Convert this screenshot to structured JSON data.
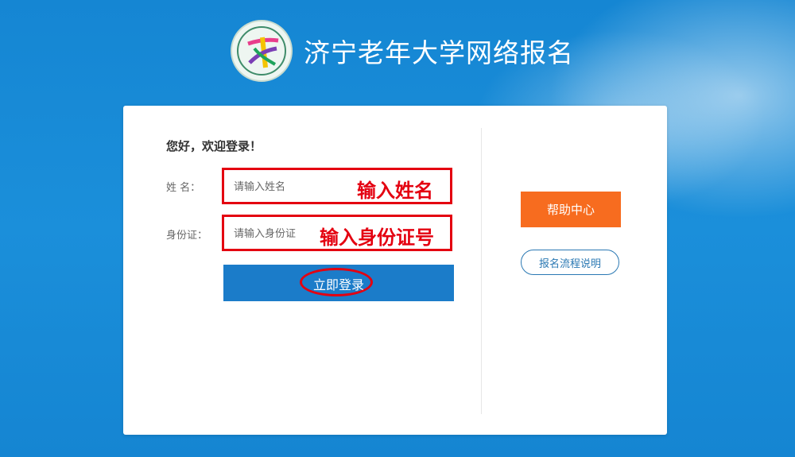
{
  "header": {
    "title": "济宁老年大学网络报名",
    "logo_icon": "school-emblem-icon"
  },
  "login": {
    "greeting": "您好，欢迎登录！",
    "name_label": "姓 名：",
    "name_placeholder": "请输入姓名",
    "name_annotation": "输入姓名",
    "id_label": "身份证：",
    "id_placeholder": "请输入身份证",
    "id_annotation": "输入身份证号",
    "submit_label": "立即登录"
  },
  "sidebar": {
    "help_label": "帮助中心",
    "flow_label": "报名流程说明"
  },
  "colors": {
    "primary": "#1b7cc9",
    "help": "#f76c1f",
    "annotation": "#e40010",
    "background": "#1586d3"
  }
}
